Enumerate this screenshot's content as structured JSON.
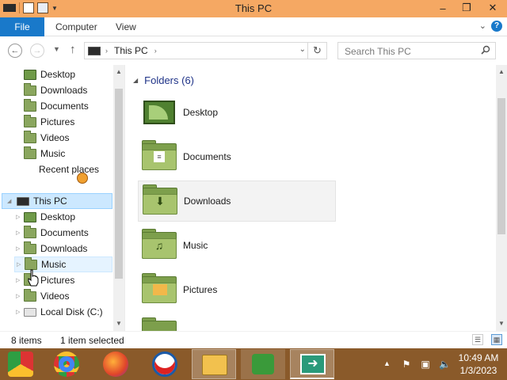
{
  "window": {
    "title": "This PC"
  },
  "ribbon": {
    "file": "File",
    "tabs": [
      "Computer",
      "View"
    ]
  },
  "address": {
    "crumb": "This PC"
  },
  "search": {
    "placeholder": "Search This PC"
  },
  "nav": {
    "favorites": [
      "Desktop",
      "Downloads",
      "Documents",
      "Pictures",
      "Videos",
      "Music",
      "Recent places"
    ],
    "this_pc": "This PC",
    "pc_children": [
      "Desktop",
      "Documents",
      "Downloads",
      "Music",
      "Pictures",
      "Videos",
      "Local Disk (C:)"
    ]
  },
  "content": {
    "group": "Folders (6)",
    "folders": [
      "Desktop",
      "Documents",
      "Downloads",
      "Music",
      "Pictures"
    ]
  },
  "status": {
    "count": "8 items",
    "selected": "1 item selected"
  },
  "clock": {
    "time": "10:49 AM",
    "date": "1/3/2023"
  },
  "colors": {
    "titlebar": "#f5a863",
    "file_tab": "#1979ca",
    "taskbar": "#8a5a2a",
    "selection": "#cce8ff",
    "group_header": "#1e3287"
  },
  "icons": {
    "titlebar": [
      "properties-icon",
      "new-folder-icon",
      "customize-dropdown-icon",
      "minimize-icon",
      "maximize-icon",
      "close-icon"
    ],
    "nav": [
      "back-icon",
      "forward-icon",
      "recent-locations-icon",
      "up-icon",
      "refresh-icon",
      "search-icon"
    ],
    "taskbar": [
      "chrome-icon",
      "chrome-icon",
      "firefox-icon",
      "obama-logo-icon",
      "file-explorer-icon",
      "network-users-icon",
      "remote-desktop-icon"
    ],
    "tray": [
      "show-hidden-icons-icon",
      "flag-icon",
      "network-icon",
      "volume-icon"
    ]
  }
}
